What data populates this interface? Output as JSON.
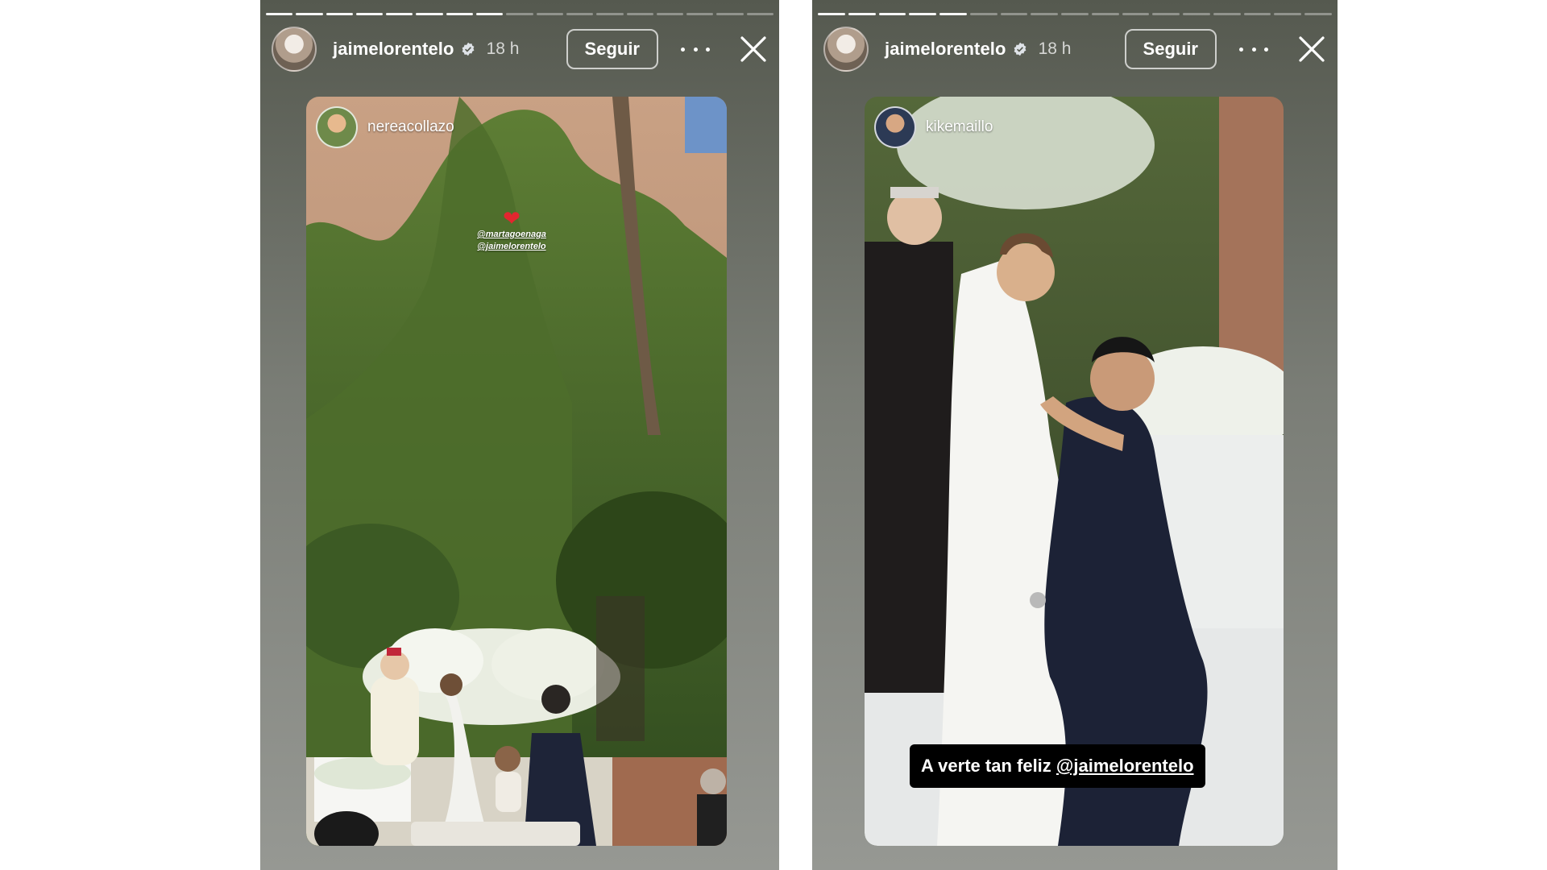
{
  "stories": [
    {
      "progress": {
        "total_segments": 17,
        "filled_segments": 8
      },
      "username": "jaimelorentelo",
      "verified": true,
      "time": "18 h",
      "follow_label": "Seguir",
      "repost_username": "nereacollazo",
      "heart": "❤",
      "mentions": [
        "@martagoenaga",
        "@jaimelorentelo"
      ]
    },
    {
      "progress": {
        "total_segments": 17,
        "filled_segments": 5
      },
      "username": "jaimelorentelo",
      "verified": true,
      "time": "18 h",
      "follow_label": "Seguir",
      "repost_username": "kikemaillo",
      "caption_text": "A verte tan feliz",
      "caption_mention": "@jaimelorentelo"
    }
  ],
  "colors": {
    "verified": "#3897f0",
    "heart": "#e3262f"
  }
}
